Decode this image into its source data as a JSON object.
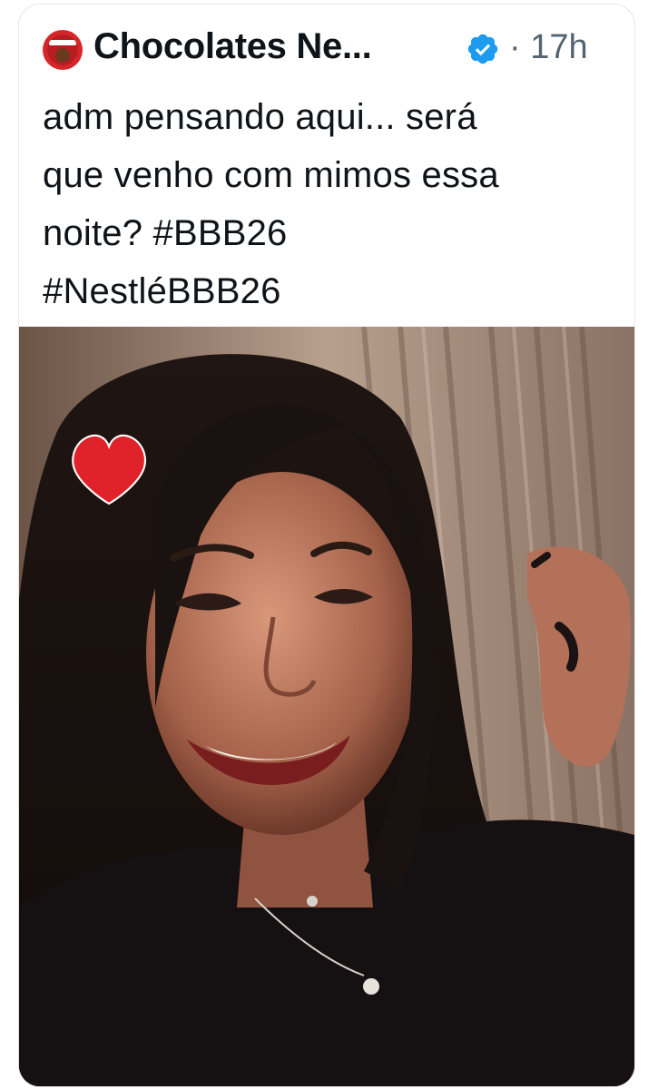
{
  "tweet": {
    "author_name": "Chocolates Ne...",
    "separator": "·",
    "time": "17h",
    "text_lines": [
      "adm pensando aqui... será",
      "que venho com mimos essa",
      "noite?  #BBB26",
      "#NestléBBB26"
    ],
    "avatar_icon": "nestle-logo-icon",
    "verified_icon": "verified-badge-icon",
    "colors": {
      "verified": "#1d9bf0",
      "avatar": "#d6262a",
      "text": "#0f1419",
      "muted": "#536471"
    }
  },
  "media": {
    "image_icon": "photo-woman-smiling-heart"
  }
}
